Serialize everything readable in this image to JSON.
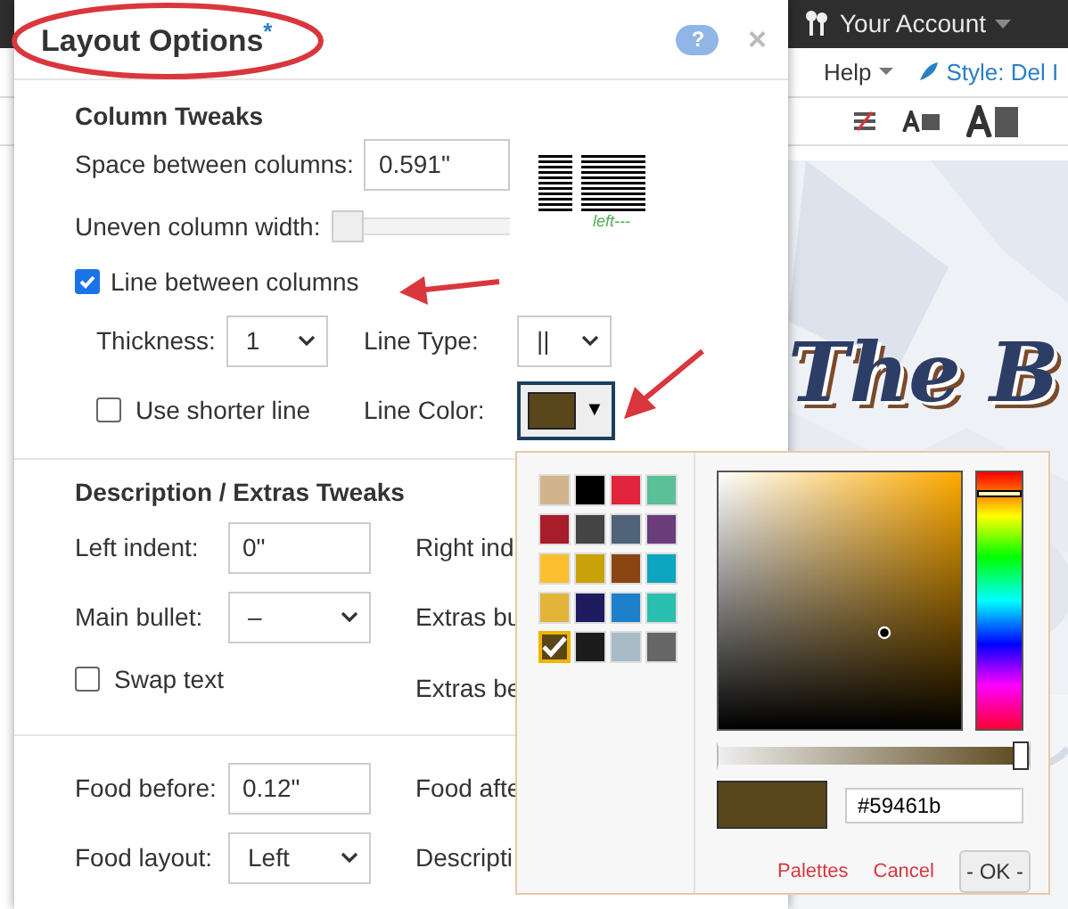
{
  "app": {
    "account": "Your Account",
    "help": "Help",
    "style_link": "Style: Del I",
    "canvas_title": "The B"
  },
  "window": {
    "title": "Layout Options",
    "modified_mark": "*",
    "help_button": "?",
    "close_button": "×"
  },
  "column_tweaks": {
    "heading": "Column Tweaks",
    "space_between": {
      "label": "Space between columns:",
      "value": "0.591\""
    },
    "uneven_width": {
      "label": "Uneven column width:",
      "level": 0
    },
    "preview_caption": "left---",
    "line_between": {
      "label": "Line between columns",
      "checked": true
    },
    "thickness": {
      "label": "Thickness:",
      "value": "1"
    },
    "line_type": {
      "label": "Line Type:",
      "value": "||"
    },
    "shorter_line": {
      "label": "Use shorter line",
      "checked": false
    },
    "line_color": {
      "label": "Line Color:",
      "color": "#59461b",
      "caret": "▼"
    }
  },
  "description_tweaks": {
    "heading": "Description / Extras Tweaks",
    "left_indent": {
      "label": "Left indent:",
      "value": "0\""
    },
    "right_indent_label": "Right ind",
    "main_bullet": {
      "label": "Main bullet:",
      "value": "–"
    },
    "extras_bullet_label": "Extras bu",
    "swap_text": {
      "label": "Swap text",
      "checked": false
    },
    "extras_before_label": "Extras be"
  },
  "food_tweaks": {
    "food_before": {
      "label": "Food before:",
      "value": "0.12\""
    },
    "food_after_label": "Food afte",
    "food_layout": {
      "label": "Food layout:",
      "value": "Left"
    },
    "description_label": "Descripti"
  },
  "color_picker": {
    "swatches": [
      {
        "color": "#d2b48c",
        "selected": false
      },
      {
        "color": "#000000",
        "selected": false
      },
      {
        "color": "#e0243c",
        "selected": false
      },
      {
        "color": "#5bbf98",
        "selected": false
      },
      {
        "color": "#a71d2a",
        "selected": false
      },
      {
        "color": "#444444",
        "selected": false
      },
      {
        "color": "#4f6378",
        "selected": false
      },
      {
        "color": "#6a3d7a",
        "selected": false
      },
      {
        "color": "#fbbf30",
        "selected": false
      },
      {
        "color": "#c9a20a",
        "selected": false
      },
      {
        "color": "#8b4513",
        "selected": false
      },
      {
        "color": "#0ea5c0",
        "selected": false
      },
      {
        "color": "#e2b43a",
        "selected": false
      },
      {
        "color": "#1e1b5e",
        "selected": false
      },
      {
        "color": "#1e7fcb",
        "selected": false
      },
      {
        "color": "#2bbfb0",
        "selected": false
      },
      {
        "color": "#59461b",
        "selected": true
      },
      {
        "color": "#1c1c1c",
        "selected": false
      },
      {
        "color": "#aabbc8",
        "selected": false
      },
      {
        "color": "#666666",
        "selected": false
      }
    ],
    "opacity": {
      "level": 1
    },
    "hex": "#59461b",
    "buttons": [
      {
        "label": "Palettes",
        "kind": "link"
      },
      {
        "label": "Cancel",
        "kind": "link"
      },
      {
        "label": "- OK -",
        "kind": "button"
      }
    ]
  }
}
